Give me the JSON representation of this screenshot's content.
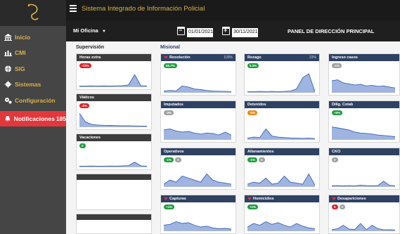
{
  "app": {
    "title": "Sistema Integrado de Información Policial"
  },
  "sidebar": {
    "items": [
      {
        "label": "Inicio",
        "icon": "bank-icon",
        "active": false
      },
      {
        "label": "CMI",
        "icon": "bar-chart-icon",
        "active": false
      },
      {
        "label": "SIG",
        "icon": "globe-icon",
        "active": false
      },
      {
        "label": "Sistemas",
        "icon": "gear-icon",
        "active": false
      },
      {
        "label": "Configuración",
        "icon": "gears-icon",
        "active": false
      },
      {
        "label": "Notificaciones",
        "icon": "bell-icon",
        "active": true,
        "badge": "185"
      }
    ]
  },
  "toolbar": {
    "office_label": "Mi Oficina",
    "date_from": "01/01/2021",
    "date_to": "30/11/2021",
    "panel_title": "PANEL DE DIRECCIÓN PRINCIPAL"
  },
  "sections": {
    "supervision": "Supervisión",
    "misional": "Misional"
  },
  "colors": {
    "accent_gold": "#d8b24a",
    "active_red": "#e2373c",
    "header_navy": "#2e4163",
    "chart_fill": "#9fb4e0",
    "chart_line": "#3f63b5"
  },
  "supervision_cards": [
    {
      "title": "Horas extra",
      "pills": [
        {
          "text": "-72%",
          "color": "red"
        }
      ]
    },
    {
      "title": "Viáticos",
      "pills": [
        {
          "text": "-2%",
          "color": "red"
        }
      ]
    },
    {
      "title": "Vacaciones",
      "pills": [
        {
          "text": "0",
          "color": "green"
        }
      ]
    }
  ],
  "misional_cards": [
    {
      "title": "Resolución",
      "pct": "100%",
      "alert": true,
      "pills": [
        {
          "text": "65.7%",
          "color": "green"
        }
      ],
      "values": [
        0.05,
        0.08,
        0.06,
        0.3,
        0.25,
        0.15,
        0.12,
        0.08,
        0.05,
        0.04,
        0.03,
        0.02
      ]
    },
    {
      "title": "Rezago",
      "pct": "23%",
      "alert": false,
      "pills": [
        {
          "text": "5.3%",
          "color": "green"
        }
      ],
      "values": [
        0.02,
        0.02,
        0.03,
        0.02,
        0.03,
        0.02,
        0.03,
        0.05,
        0.15,
        0.7,
        0.9,
        0.02
      ]
    },
    {
      "title": "Ingreso casos",
      "pct": "",
      "alert": false,
      "pills": [
        {
          "text": "-1%",
          "color": "gray"
        }
      ],
      "values": [
        0.55,
        0.6,
        0.45,
        0.4,
        0.35,
        0.38,
        0.3,
        0.33,
        0.28,
        0.3,
        0.25,
        0.2
      ]
    },
    {
      "title": "Imputados",
      "pct": "",
      "alert": false,
      "pills": [
        {
          "text": "-3%",
          "color": "gray"
        }
      ],
      "values": [
        0.45,
        0.5,
        0.4,
        0.35,
        0.38,
        0.3,
        0.25,
        0.3,
        0.28,
        0.2,
        0.35,
        0.2
      ]
    },
    {
      "title": "Detenidos",
      "pct": "",
      "alert": false,
      "pills": [
        {
          "text": "-5%",
          "color": "orange"
        }
      ],
      "values": [
        0.05,
        0.1,
        0.08,
        0.5,
        0.15,
        0.1,
        0.08,
        0.06,
        0.05,
        0.04,
        0.05,
        0.03
      ]
    },
    {
      "title": "Dilig. Colab",
      "pct": "",
      "alert": false,
      "pills": [
        {
          "text": "+5%",
          "color": "green"
        }
      ],
      "values": [
        0.6,
        0.55,
        0.5,
        0.45,
        0.35,
        0.3,
        0.28,
        0.25,
        0.2,
        0.18,
        0.15,
        0.12
      ]
    },
    {
      "title": "Operativos",
      "pct": "",
      "alert": false,
      "pills": [
        {
          "text": "-1%",
          "color": "green"
        },
        {
          "text": "0",
          "color": "gray"
        }
      ],
      "values": [
        0.1,
        0.3,
        0.2,
        0.5,
        0.4,
        0.3,
        0.2,
        0.6,
        0.3,
        0.2,
        0.15,
        0.1
      ]
    },
    {
      "title": "Allanamientos",
      "pct": "",
      "alert": false,
      "pills": [
        {
          "text": "-1%",
          "color": "green"
        },
        {
          "text": "0",
          "color": "gray"
        }
      ],
      "values": [
        0.1,
        0.2,
        0.15,
        0.4,
        0.1,
        0.15,
        0.5,
        0.2,
        0.15,
        0.1,
        0.6,
        0.05
      ]
    },
    {
      "title": "CKO",
      "pct": "",
      "alert": false,
      "pills": [
        {
          "text": "0",
          "color": "gray"
        }
      ],
      "values": [
        0.02,
        0.03,
        0.02,
        0.03,
        0.02,
        0.05,
        0.03,
        0.02,
        0.03,
        0.25,
        0.05,
        0.02
      ]
    },
    {
      "title": "Capturas",
      "pct": "",
      "alert": true,
      "pills": [
        {
          "text": "+1%",
          "color": "green"
        }
      ],
      "values": [
        0.3,
        0.35,
        0.5,
        0.4,
        0.45,
        0.3,
        0.2,
        0.25,
        0.15,
        0.1,
        0.12,
        0.08
      ]
    },
    {
      "title": "Homicidios",
      "pct": "",
      "alert": true,
      "pills": [
        {
          "text": "+1%",
          "color": "green"
        }
      ],
      "values": [
        0.2,
        0.4,
        0.3,
        0.5,
        0.35,
        0.45,
        0.3,
        0.2,
        0.4,
        0.25,
        0.15,
        0.1
      ]
    },
    {
      "title": "Desapariciones",
      "pct": "",
      "alert": true,
      "pills": [
        {
          "text": "0",
          "color": "red"
        },
        {
          "text": "0",
          "color": "gray"
        }
      ],
      "values": [
        0.05,
        0.1,
        0.3,
        0.08,
        0.06,
        0.4,
        0.05,
        0.3,
        0.1,
        0.05,
        0.04,
        0.03
      ]
    }
  ],
  "supervision_values": [
    [
      0.03,
      0.03,
      0.04,
      0.03,
      0.04,
      0.03,
      0.04,
      0.05,
      0.1,
      0.8,
      0.05,
      0.03
    ],
    [
      0.9,
      0.3,
      0.15,
      0.1,
      0.08,
      0.07,
      0.06,
      0.05,
      0.05,
      0.04,
      0.03,
      0.03
    ],
    [
      0.03,
      0.03,
      0.04,
      0.03,
      0.03,
      0.04,
      0.03,
      0.05,
      0.06,
      0.3,
      0.05,
      0.03
    ]
  ]
}
